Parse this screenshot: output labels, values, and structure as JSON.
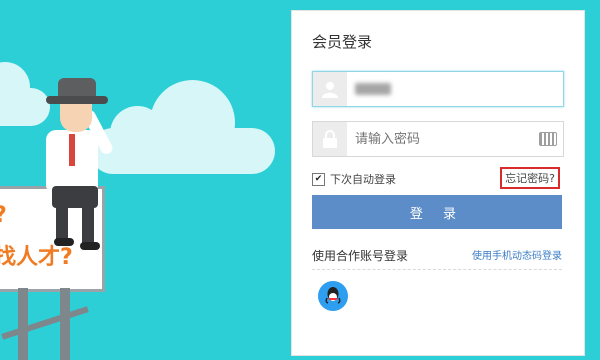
{
  "login": {
    "title": "会员登录",
    "username_value": "",
    "password_placeholder": "请输入密码",
    "remember_label": "下次自动登录",
    "forgot_link": "忘记密码?",
    "submit_label": "登 录",
    "partner_label": "使用合作账号登录",
    "mobile_link": "使用手机动态码登录"
  },
  "billboard": {
    "line1": "?",
    "line2": "找人才?"
  },
  "colors": {
    "background": "#2ccfd6",
    "primary_button": "#5c8dc8",
    "link": "#3b7cc6",
    "highlight": "#d92b2b",
    "qq": "#2d9ef0"
  },
  "icons": [
    "user-icon",
    "lock-icon",
    "keyboard-icon",
    "qq-icon"
  ]
}
